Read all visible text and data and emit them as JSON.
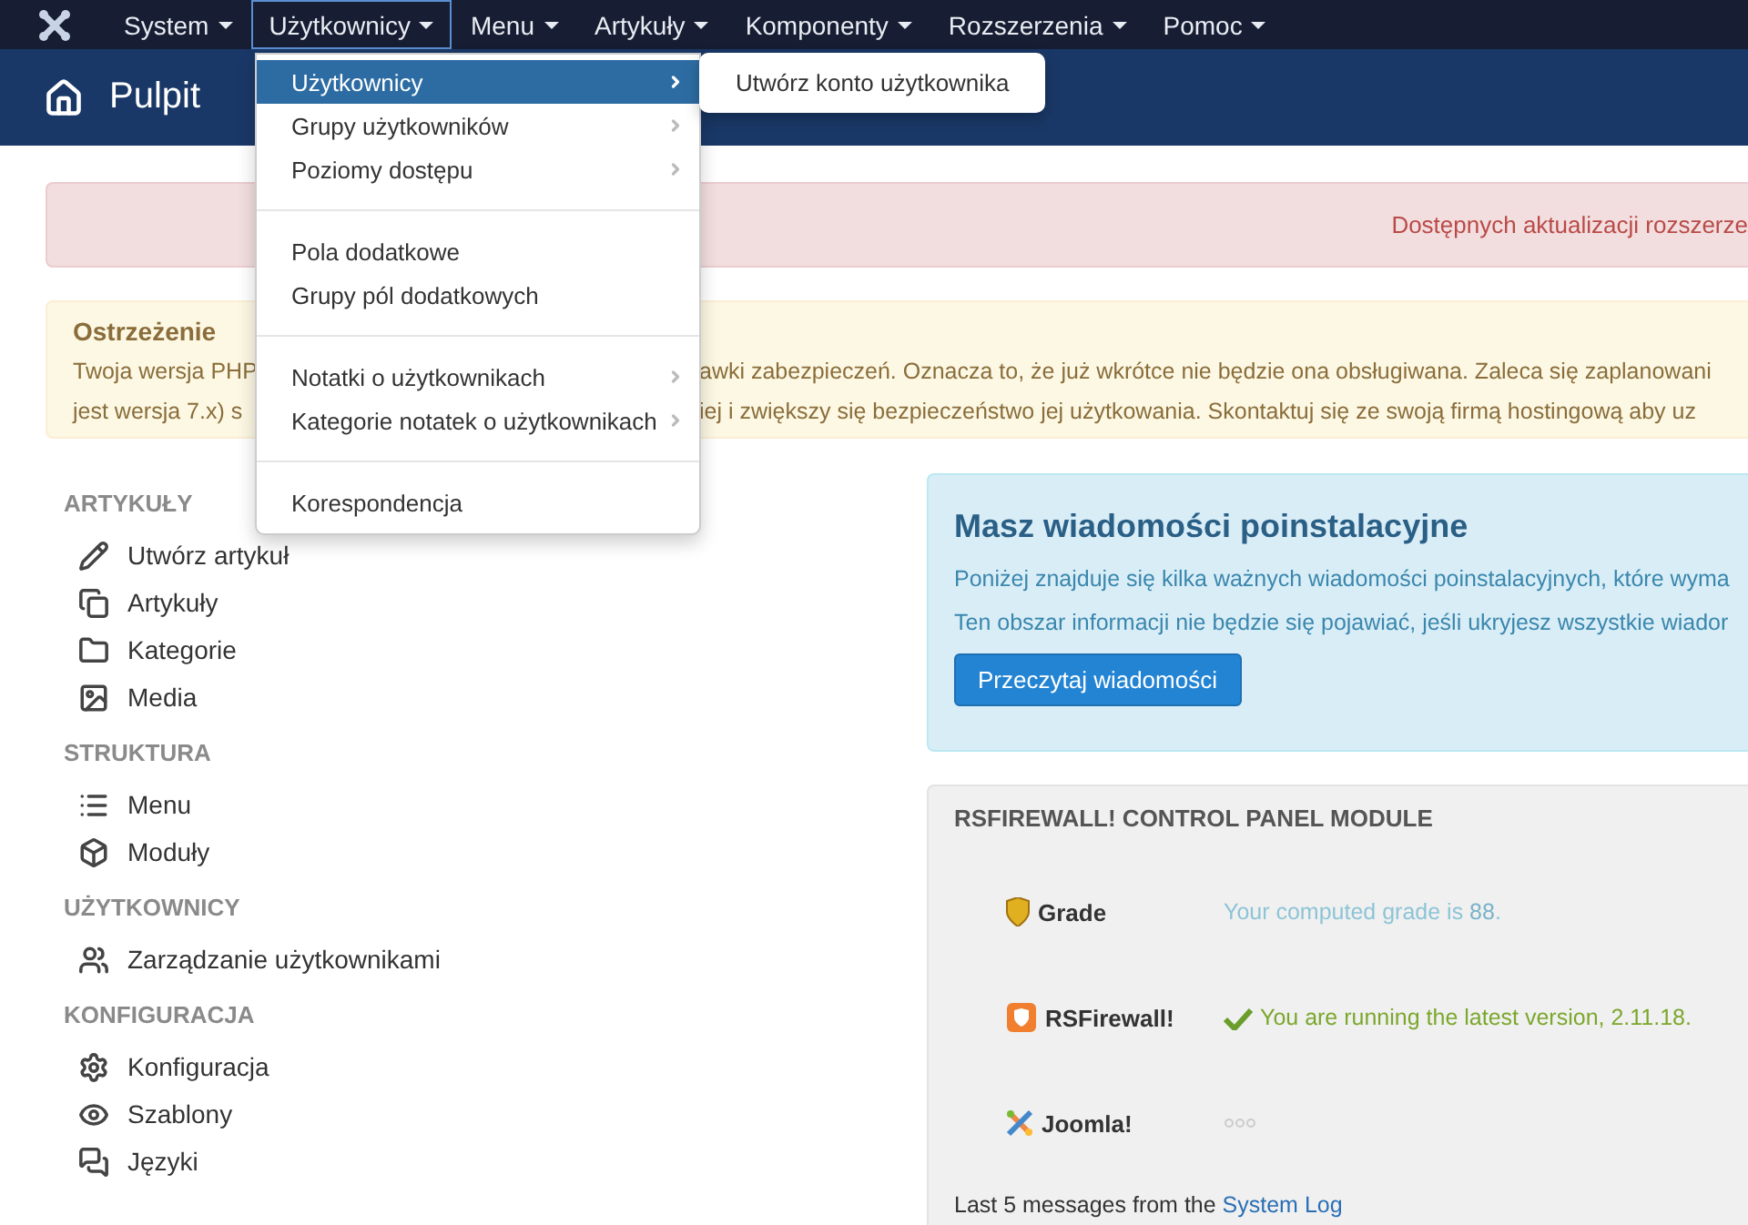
{
  "nav": {
    "items": [
      {
        "label": "System",
        "selected": false
      },
      {
        "label": "Użytkownicy",
        "selected": true
      },
      {
        "label": "Menu",
        "selected": false
      },
      {
        "label": "Artykuły",
        "selected": false
      },
      {
        "label": "Komponenty",
        "selected": false
      },
      {
        "label": "Rozszerzenia",
        "selected": false
      },
      {
        "label": "Pomoc",
        "selected": false
      }
    ]
  },
  "dropdown": {
    "groups": [
      [
        {
          "label": "Użytkownicy",
          "submenu": true,
          "selected": true
        },
        {
          "label": "Grupy użytkowników",
          "submenu": true,
          "selected": false
        },
        {
          "label": "Poziomy dostępu",
          "submenu": true,
          "selected": false
        }
      ],
      [
        {
          "label": "Pola dodatkowe",
          "submenu": false,
          "selected": false
        },
        {
          "label": "Grupy pól dodatkowych",
          "submenu": false,
          "selected": false
        }
      ],
      [
        {
          "label": "Notatki o użytkownikach",
          "submenu": true,
          "selected": false
        },
        {
          "label": "Kategorie notatek o użytkownikach",
          "submenu": true,
          "selected": false
        }
      ],
      [
        {
          "label": "Korespondencja",
          "submenu": false,
          "selected": false
        }
      ]
    ],
    "submenu": [
      "Utwórz konto użytkownika"
    ]
  },
  "header": {
    "title": "Pulpit"
  },
  "update_alert": {
    "text": "Dostępnych aktualizacji rozszerze"
  },
  "warning": {
    "title": "Ostrzeżenie",
    "lines": [
      [
        "Twoja wersja PHP",
        "awki zabezpieczeń. Oznacza to, że już wkrótce nie będzie ona obsługiwana. Zaleca się zaplanowani"
      ],
      [
        "jest wersja 7.x) s",
        "iej i zwiększy się bezpieczeństwo jej użytkowania. Skontaktuj się ze swoją firmą hostingową aby uz"
      ]
    ]
  },
  "sidebar": [
    {
      "heading": "ARTYKUŁY",
      "items": [
        "Utwórz artykuł",
        "Artykuły",
        "Kategorie",
        "Media"
      ]
    },
    {
      "heading": "STRUKTURA",
      "items": [
        "Menu",
        "Moduły"
      ]
    },
    {
      "heading": "UŻYTKOWNICY",
      "items": [
        "Zarządzanie użytkownikami"
      ]
    },
    {
      "heading": "KONFIGURACJA",
      "items": [
        "Konfiguracja",
        "Szablony",
        "Języki"
      ]
    }
  ],
  "postinstall": {
    "title": "Masz wiadomości poinstalacyjne",
    "paragraphs": [
      "Poniżej znajduje się kilka ważnych wiadomości poinstalacyjnych, które wyma",
      "Ten obszar informacji nie będzie się pojawiać, jeśli ukryjesz wszystkie wiador"
    ],
    "button": "Przeczytaj wiadomości"
  },
  "firewall": {
    "title": "RSFIREWALL! CONTROL PANEL MODULE",
    "rows": [
      {
        "kind": "grade",
        "label": "Grade",
        "value": "Your computed grade is **88**."
      },
      {
        "kind": "ok",
        "label": "RSFirewall!",
        "value": "You are running the latest version, 2.11.18."
      },
      {
        "kind": "loading",
        "label": "Joomla!"
      }
    ],
    "footer": "Last 5 messages from the ",
    "footer_link": "System Log"
  }
}
